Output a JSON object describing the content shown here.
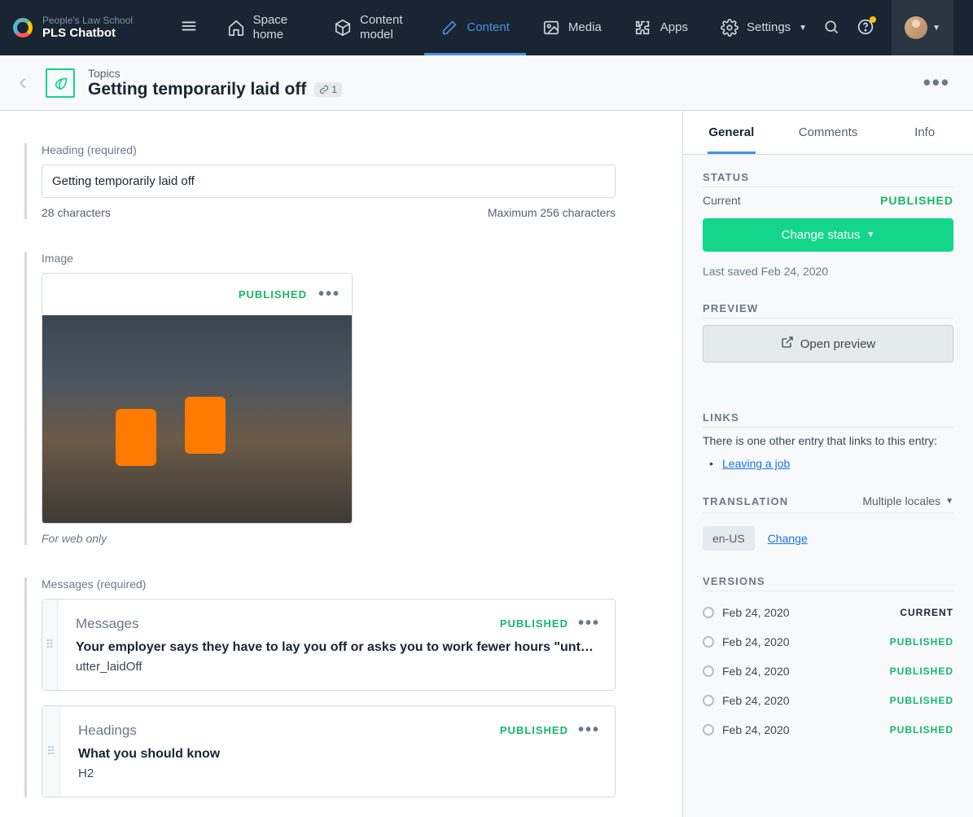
{
  "brand": {
    "org": "People's Law School",
    "name": "PLS Chatbot"
  },
  "nav": {
    "space_home": "Space home",
    "content_model": "Content model",
    "content": "Content",
    "media": "Media",
    "apps": "Apps",
    "settings": "Settings"
  },
  "page": {
    "breadcrumb": "Topics",
    "title": "Getting temporarily laid off",
    "link_count": "1"
  },
  "fields": {
    "heading": {
      "label": "Heading (required)",
      "value": "Getting temporarily laid off",
      "char_count": "28 characters",
      "max": "Maximum 256 characters"
    },
    "image": {
      "label": "Image",
      "status": "PUBLISHED",
      "helper": "For web only"
    },
    "messages": {
      "label": "Messages (required)",
      "items": [
        {
          "type": "Messages",
          "status": "PUBLISHED",
          "title": "Your employer says they have to lay you off or asks you to work fewer hours \"until thi…",
          "sub": "utter_laidOff"
        },
        {
          "type": "Headings",
          "status": "PUBLISHED",
          "title": "What you should know",
          "sub": "H2"
        }
      ]
    }
  },
  "sidebar": {
    "tabs": {
      "general": "General",
      "comments": "Comments",
      "info": "Info"
    },
    "status": {
      "heading": "STATUS",
      "current_label": "Current",
      "current_value": "PUBLISHED",
      "change_status": "Change status",
      "last_saved": "Last saved Feb 24, 2020"
    },
    "preview": {
      "heading": "PREVIEW",
      "open": "Open preview"
    },
    "links": {
      "heading": "LINKS",
      "text": "There is one other entry that links to this entry:",
      "item": "Leaving a job"
    },
    "translation": {
      "heading": "TRANSLATION",
      "value": "Multiple locales",
      "locale": "en-US",
      "change": "Change"
    },
    "versions": {
      "heading": "VERSIONS",
      "items": [
        {
          "date": "Feb 24, 2020",
          "status": "CURRENT",
          "kind": "current"
        },
        {
          "date": "Feb 24, 2020",
          "status": "PUBLISHED",
          "kind": "published"
        },
        {
          "date": "Feb 24, 2020",
          "status": "PUBLISHED",
          "kind": "published"
        },
        {
          "date": "Feb 24, 2020",
          "status": "PUBLISHED",
          "kind": "published"
        },
        {
          "date": "Feb 24, 2020",
          "status": "PUBLISHED",
          "kind": "published"
        }
      ]
    }
  }
}
